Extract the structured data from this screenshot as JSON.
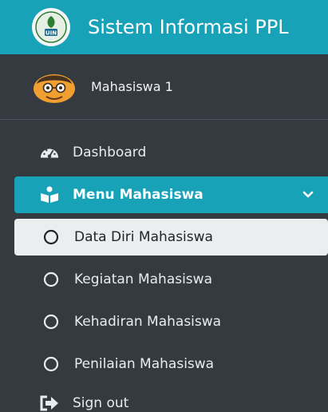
{
  "brand": {
    "title": "Sistem Informasi PPL",
    "logo_text": "UIN"
  },
  "user": {
    "name": "Mahasiswa 1"
  },
  "menu": {
    "dashboard": "Dashboard",
    "menu_mahasiswa": "Menu Mahasiswa",
    "sub_items": [
      "Data Diri Mahasiswa",
      "Kegiatan Mahasiswa",
      "Kehadiran Mahasiswa",
      "Penilaian Mahasiswa"
    ],
    "sign_out": "Sign out"
  },
  "colors": {
    "sidebar_bg": "#343a40",
    "accent": "#17a2b8",
    "selected_bg": "#ebedee"
  },
  "icons": {
    "dashboard": "tachometer-icon",
    "menu_mahasiswa": "book-reader-icon",
    "sub_item": "circle-outline-icon",
    "sign_out": "sign-out-icon",
    "expand": "chevron-down-icon"
  }
}
